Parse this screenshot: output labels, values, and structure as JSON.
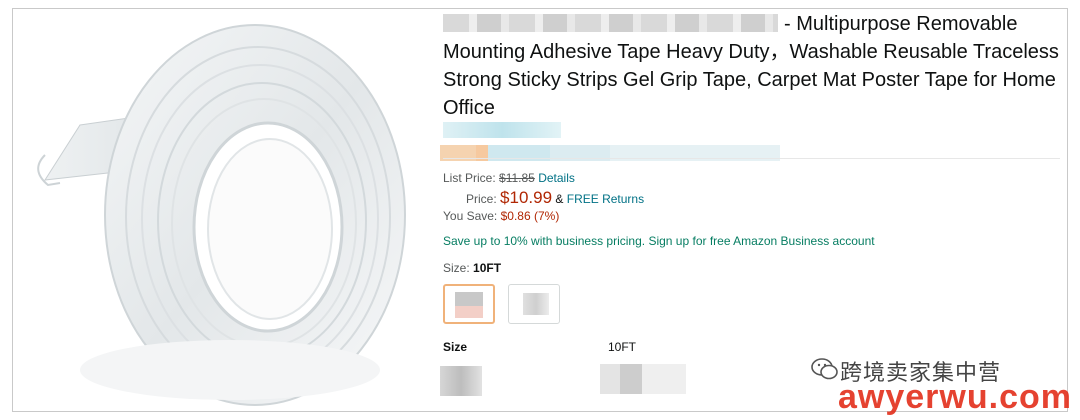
{
  "product": {
    "title": "- Multipurpose Removable Mounting Adhesive Tape Heavy Duty，Washable Reusable Traceless Strong Sticky Strips Gel Grip Tape, Carpet Mat Poster Tape for Home Office",
    "image_alt": "clear double-sided tape roll"
  },
  "pricing": {
    "list_price_label": "List Price:",
    "list_price": "$11.85",
    "details_link": "Details",
    "price_label": "Price:",
    "price": "$10.99",
    "amp": "&",
    "free_returns": "FREE Returns",
    "you_save_label": "You Save:",
    "you_save": "$0.86 (7%)",
    "business": "Save up to 10% with business pricing. Sign up for free Amazon Business account"
  },
  "size": {
    "label": "Size:",
    "selected": "10FT"
  },
  "specs": {
    "key": "Size",
    "value": "10FT"
  },
  "watermark": {
    "chinese": "跨境卖家集中营",
    "url": "awyerwu.com"
  },
  "colors": {
    "price_red": "#b12704",
    "link_teal": "#007185",
    "business_green": "#067d62",
    "watermark_red": "#e3321f",
    "selected_swatch_border": "#f0b27a"
  }
}
